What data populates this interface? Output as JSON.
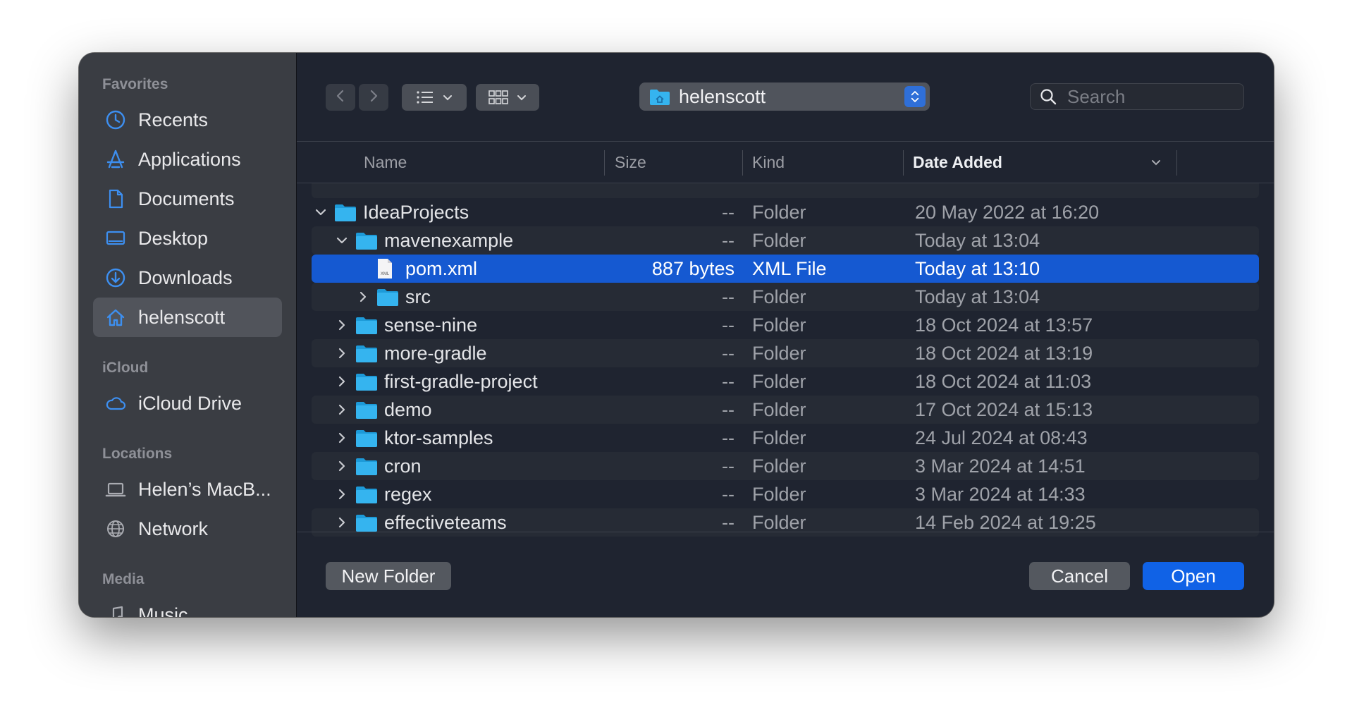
{
  "sidebar": {
    "sections": [
      {
        "title": "Favorites",
        "items": [
          {
            "label": "Recents",
            "icon": "clock-icon"
          },
          {
            "label": "Applications",
            "icon": "applications-icon"
          },
          {
            "label": "Documents",
            "icon": "document-icon"
          },
          {
            "label": "Desktop",
            "icon": "desktop-icon"
          },
          {
            "label": "Downloads",
            "icon": "download-icon"
          },
          {
            "label": "helenscott",
            "icon": "home-icon",
            "selected": true
          }
        ]
      },
      {
        "title": "iCloud",
        "items": [
          {
            "label": "iCloud Drive",
            "icon": "cloud-icon"
          }
        ]
      },
      {
        "title": "Locations",
        "items": [
          {
            "label": "Helen’s MacB...",
            "icon": "laptop-icon"
          },
          {
            "label": "Network",
            "icon": "globe-icon"
          }
        ]
      },
      {
        "title": "Media",
        "items": [
          {
            "label": "Music",
            "icon": "music-note-icon"
          }
        ]
      }
    ]
  },
  "toolbar": {
    "location": "helenscott",
    "search_placeholder": "Search"
  },
  "columns": {
    "name": "Name",
    "size": "Size",
    "kind": "Kind",
    "date_added": "Date Added"
  },
  "rows": [
    {
      "name": "IdeaProjects",
      "size": "--",
      "kind": "Folder",
      "date": "20 May 2022 at 16:20",
      "level": 0,
      "expanded": true,
      "type": "folder"
    },
    {
      "name": "mavenexample",
      "size": "--",
      "kind": "Folder",
      "date": "Today at 13:04",
      "level": 1,
      "expanded": true,
      "type": "folder"
    },
    {
      "name": "pom.xml",
      "size": "887 bytes",
      "kind": "XML File",
      "date": "Today at 13:10",
      "level": 2,
      "type": "file",
      "selected": true
    },
    {
      "name": "src",
      "size": "--",
      "kind": "Folder",
      "date": "Today at 13:04",
      "level": 2,
      "expanded": false,
      "type": "folder"
    },
    {
      "name": "sense-nine",
      "size": "--",
      "kind": "Folder",
      "date": "18 Oct 2024 at 13:57",
      "level": 1,
      "expanded": false,
      "type": "folder"
    },
    {
      "name": "more-gradle",
      "size": "--",
      "kind": "Folder",
      "date": "18 Oct 2024 at 13:19",
      "level": 1,
      "expanded": false,
      "type": "folder"
    },
    {
      "name": "first-gradle-project",
      "size": "--",
      "kind": "Folder",
      "date": "18 Oct 2024 at 11:03",
      "level": 1,
      "expanded": false,
      "type": "folder"
    },
    {
      "name": "demo",
      "size": "--",
      "kind": "Folder",
      "date": "17 Oct 2024 at 15:13",
      "level": 1,
      "expanded": false,
      "type": "folder"
    },
    {
      "name": "ktor-samples",
      "size": "--",
      "kind": "Folder",
      "date": "24 Jul 2024 at 08:43",
      "level": 1,
      "expanded": false,
      "type": "folder"
    },
    {
      "name": "cron",
      "size": "--",
      "kind": "Folder",
      "date": "3 Mar 2024 at 14:51",
      "level": 1,
      "expanded": false,
      "type": "folder"
    },
    {
      "name": "regex",
      "size": "--",
      "kind": "Folder",
      "date": "3 Mar 2024 at 14:33",
      "level": 1,
      "expanded": false,
      "type": "folder"
    },
    {
      "name": "effectiveteams",
      "size": "--",
      "kind": "Folder",
      "date": "14 Feb 2024 at 19:25",
      "level": 1,
      "expanded": false,
      "type": "folder"
    }
  ],
  "footer": {
    "new_folder": "New Folder",
    "cancel": "Cancel",
    "open": "Open"
  },
  "colors": {
    "accent": "#1559d1",
    "folder": "#35b4ef",
    "sidebar_icon": "#3d8ff0"
  }
}
